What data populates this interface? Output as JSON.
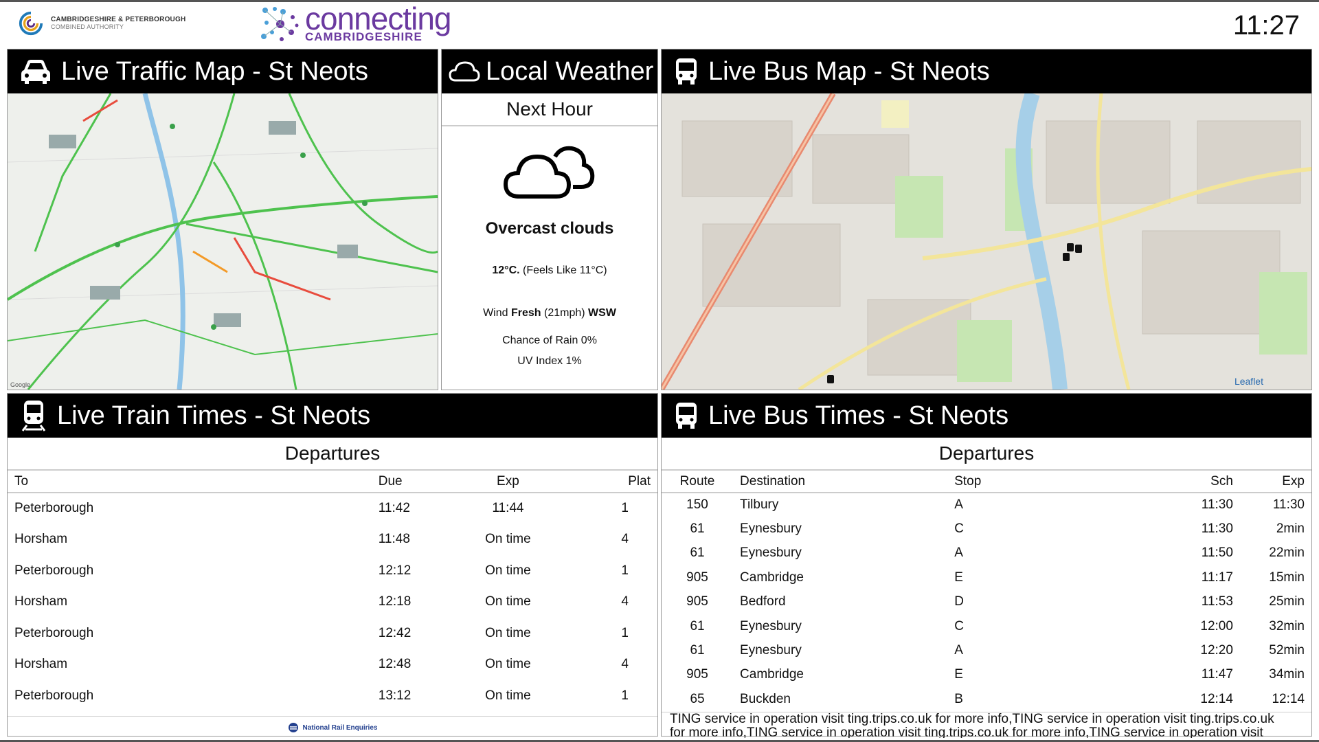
{
  "header": {
    "authority_name": "CAMBRIDGESHIRE & PETERBOROUGH",
    "authority_sub": "COMBINED AUTHORITY",
    "brand_word": "connecting",
    "brand_sub": "CAMBRIDGESHIRE",
    "clock": "11:27"
  },
  "traffic": {
    "title": "Live Traffic Map - St Neots",
    "icon": "car-icon",
    "google_label": "Google"
  },
  "weather": {
    "title": "Local Weather",
    "icon": "cloud-icon",
    "subtitle": "Next Hour",
    "description": "Overcast clouds",
    "temp": "12°C.",
    "feels": "(Feels Like 11°C)",
    "wind_prefix": "Wind",
    "wind_strength": "Fresh",
    "wind_speed": "(21mph)",
    "wind_dir": "WSW",
    "rain": "Chance of Rain 0%",
    "uv": "UV Index 1%"
  },
  "busmap": {
    "title": "Live Bus Map - St Neots",
    "icon": "bus-icon",
    "attribution": "Leaflet"
  },
  "trains": {
    "title": "Live Train Times - St Neots",
    "icon": "train-icon",
    "subtitle": "Departures",
    "columns": [
      "To",
      "Due",
      "Exp",
      "Plat"
    ],
    "rows": [
      [
        "Peterborough",
        "11:42",
        "11:44",
        "1"
      ],
      [
        "Horsham",
        "11:48",
        "On time",
        "4"
      ],
      [
        "Peterborough",
        "12:12",
        "On time",
        "1"
      ],
      [
        "Horsham",
        "12:18",
        "On time",
        "4"
      ],
      [
        "Peterborough",
        "12:42",
        "On time",
        "1"
      ],
      [
        "Horsham",
        "12:48",
        "On time",
        "4"
      ],
      [
        "Peterborough",
        "13:12",
        "On time",
        "1"
      ]
    ],
    "footer": "National Rail Enquiries"
  },
  "buses": {
    "title": "Live Bus Times - St Neots",
    "icon": "bus-icon",
    "subtitle": "Departures",
    "columns": [
      "Route",
      "Destination",
      "Stop",
      "Sch",
      "Exp"
    ],
    "rows": [
      [
        "150",
        "Tilbury",
        "A",
        "11:30",
        "11:30"
      ],
      [
        "61",
        "Eynesbury",
        "C",
        "11:30",
        "2min"
      ],
      [
        "61",
        "Eynesbury",
        "A",
        "11:50",
        "22min"
      ],
      [
        "905",
        "Cambridge",
        "E",
        "11:17",
        "15min"
      ],
      [
        "905",
        "Bedford",
        "D",
        "11:53",
        "25min"
      ],
      [
        "61",
        "Eynesbury",
        "C",
        "12:00",
        "32min"
      ],
      [
        "61",
        "Eynesbury",
        "A",
        "12:20",
        "52min"
      ],
      [
        "905",
        "Cambridge",
        "E",
        "11:47",
        "34min"
      ],
      [
        "65",
        "Buckden",
        "B",
        "12:14",
        "12:14"
      ]
    ],
    "ticker_1": "TING service in operation visit ting.trips.co.uk for more info,TING service in operation visit ting.trips.co.uk",
    "ticker_2": "for more info,TING service in operation visit ting.trips.co.uk for more info,TING service in operation visit"
  }
}
